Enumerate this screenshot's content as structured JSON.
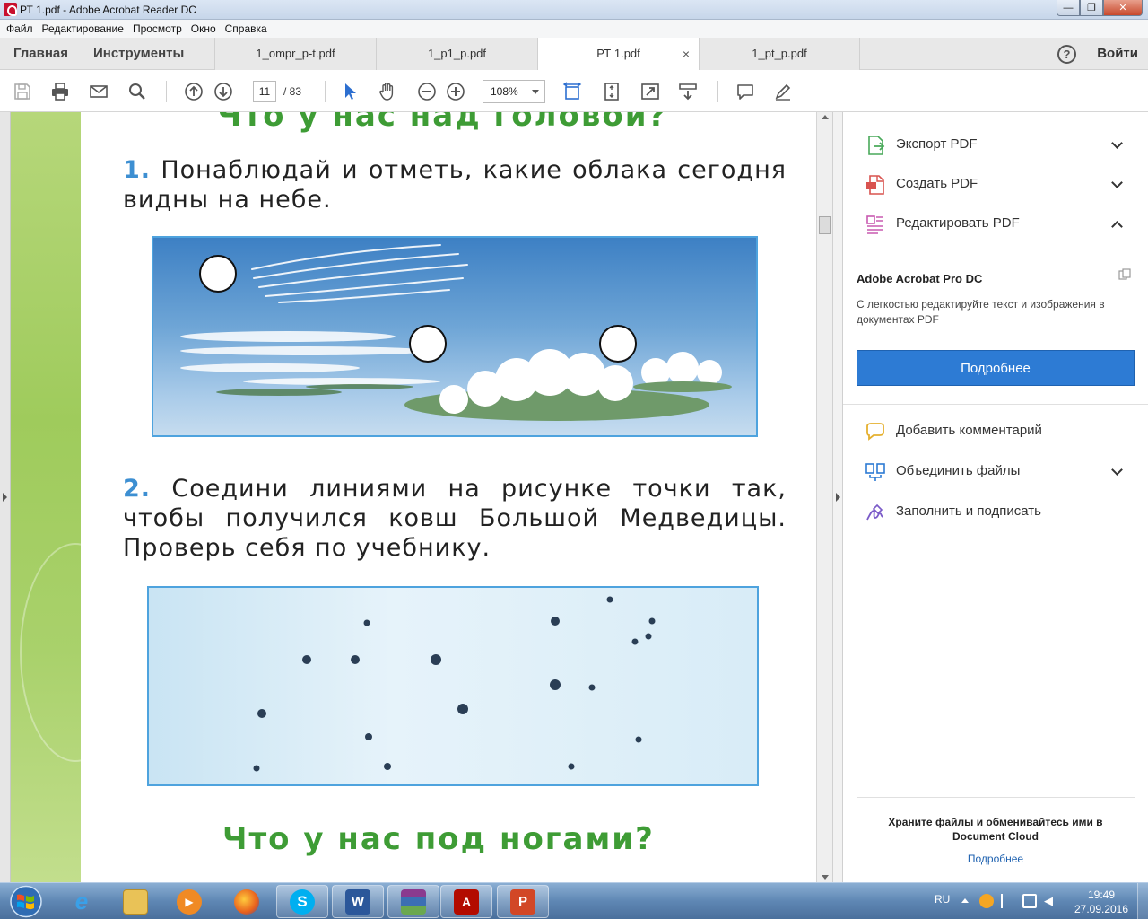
{
  "window": {
    "title": "РТ 1.pdf - Adobe Acrobat Reader DC",
    "buttons": [
      "minimize",
      "maximize",
      "close"
    ]
  },
  "menu": [
    "Файл",
    "Редактирование",
    "Просмотр",
    "Окно",
    "Справка"
  ],
  "nav": {
    "home": "Главная",
    "tools": "Инструменты",
    "signin": "Войти",
    "help": "?"
  },
  "tabs": [
    {
      "label": "1_ompr_p-t.pdf",
      "active": false
    },
    {
      "label": "1_p1_p.pdf",
      "active": false
    },
    {
      "label": "РТ 1.pdf",
      "active": true,
      "close": "×"
    },
    {
      "label": "1_pt_p.pdf",
      "active": false
    }
  ],
  "toolbar": {
    "icons": [
      "save-icon",
      "print-icon",
      "email-icon",
      "search-icon",
      "prev-page-icon",
      "next-page-icon",
      "select-cursor-icon",
      "hand-icon",
      "zoom-out-icon",
      "zoom-in-icon",
      "fit-width-icon",
      "fit-page-icon",
      "fullscreen-icon",
      "scroll-mode-icon",
      "comment-icon",
      "sign-icon"
    ],
    "page_current": "11",
    "page_total": "/ 83",
    "zoom": "108%"
  },
  "document": {
    "heading_top": "Что у нас над головой?",
    "task1_num": "1.",
    "task1_text": "Понаблюдай и отметь, какие облака сегодня видны на небе.",
    "task2_num": "2.",
    "task2_text": "Соедини линиями на рисунке точки так, чтобы получился ковш Большой Медведицы. Проверь себя по учебнику.",
    "heading_bottom": "Что у нас под ногами?",
    "accent_green": "#3e9c35",
    "accent_blue": "#3d8fd2"
  },
  "right_panel": {
    "tools_top": [
      {
        "label": "Экспорт PDF",
        "icon": "export-pdf-icon",
        "chevron": "down"
      },
      {
        "label": "Создать PDF",
        "icon": "create-pdf-icon",
        "chevron": "down"
      },
      {
        "label": "Редактировать PDF",
        "icon": "edit-pdf-icon",
        "chevron": "up"
      }
    ],
    "promo": {
      "title": "Adobe Acrobat Pro DC",
      "description": "С легкостью редактируйте текст и изображения в документах PDF",
      "button": "Подробнее"
    },
    "tools_bottom": [
      {
        "label": "Добавить комментарий",
        "icon": "comment-tool-icon",
        "chevron": ""
      },
      {
        "label": "Объединить файлы",
        "icon": "combine-files-icon",
        "chevron": "down"
      },
      {
        "label": "Заполнить и подписать",
        "icon": "fill-sign-icon",
        "chevron": ""
      }
    ],
    "cloud_text": "Храните файлы и обменивайтесь ими в Document Cloud",
    "cloud_link": "Подробнее"
  },
  "taskbar": {
    "apps": [
      "ie-icon",
      "explorer-icon",
      "media-player-icon",
      "firefox-icon",
      "skype-icon",
      "word-icon",
      "winrar-icon",
      "acrobat-icon",
      "powerpoint-icon"
    ],
    "lang": "RU",
    "time": "19:49",
    "date": "27.09.2016"
  }
}
